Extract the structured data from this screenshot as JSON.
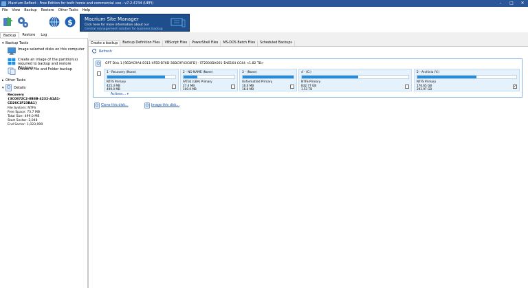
{
  "window": {
    "title": "Macrium Reflect - Free Edition for both home and commercial use - v7.2.4744  (UEFI)"
  },
  "menu": [
    "File",
    "View",
    "Backup",
    "Restore",
    "Other Tasks",
    "Help"
  ],
  "toolbar": {
    "icons": [
      "backup-wizard-icon",
      "settings-gears-icon",
      "web-globe-icon",
      "dollar-upgrade-icon"
    ],
    "banner": {
      "title": "Macrium Site Manager",
      "line1": "Click here for more information about our",
      "line2": "Central management solution for business backup"
    }
  },
  "left_tabs": [
    "Backup",
    "Restore",
    "Log"
  ],
  "left_panel": {
    "backup_tasks_header": "Backup Tasks",
    "tasks": [
      {
        "icon": "monitor-icon",
        "label": "Image selected disks on this computer"
      },
      {
        "icon": "windows-icon",
        "label": "Create an image of the partition(s) required to backup and restore Windows"
      },
      {
        "icon": "files-icon",
        "label": "Create a File and Folder backup"
      }
    ],
    "other_tasks_header": "Other Tasks",
    "details_header": "Details",
    "details": {
      "name": "Recovery",
      "guid": "{3C0872C2-8B8B-4232-A1A1-CD26C1F23BA1}",
      "file_system": "File System: NTFS",
      "free_space": "Free Space:  73.7 MB",
      "total_size": "Total Size:   499.0 MB",
      "start_sector": "Start Sector:  2,048",
      "end_sector": "End Sector:   1,023,999"
    }
  },
  "main_tabs": [
    "Create a backup",
    "Backup Definition Files",
    "VBScript Files",
    "PowerShell Files",
    "MS-DOS Batch Files",
    "Scheduled Backups"
  ],
  "refresh_label": "Refresh",
  "disk": {
    "header": "GPT Disk 1 [9EDAC9A4-E011-4FEB-B76D-38DC9F43C8FD] - ST2000DX001-1NS164 CC44  <1.82 TB>",
    "partitions": [
      {
        "label": "1 - Recovery (None)",
        "type": "NTFS Primary",
        "used": "425.3 MB",
        "total": "499.0 MB",
        "fill": 0.85,
        "checked": false
      },
      {
        "label": "2 - NO NAME (None)",
        "type": "FAT32 (LBA) Primary",
        "used": "27.4 MB",
        "total": "100.0 MB",
        "fill": 0.27,
        "checked": false
      },
      {
        "label": "3 - (None)",
        "type": "Unformatted Primary",
        "used": "16.0 MB",
        "total": "16.0 MB",
        "fill": 1.0,
        "checked": false
      },
      {
        "label": "4 - (C:)",
        "type": "NTFS Primary",
        "used": "832.77 GB",
        "total": "1.53 TB",
        "fill": 0.53,
        "checked": false
      },
      {
        "label": "5 - Archivio (V:)",
        "type": "NTFS Primary",
        "used": "176.65 GB",
        "total": "292.97 GB",
        "fill": 0.6,
        "checked": true
      }
    ],
    "actions_label": "Actions..."
  },
  "links": {
    "clone": "Clone this disk...",
    "image": "Image this disk..."
  }
}
